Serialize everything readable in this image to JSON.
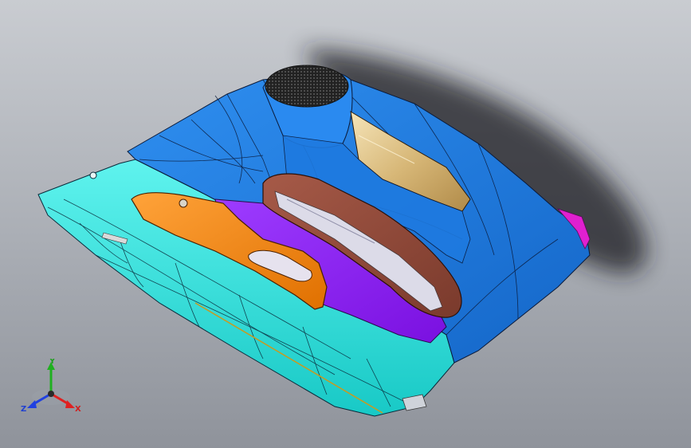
{
  "viewport": {
    "background_top": "#c9ccd1",
    "background_bottom": "#8f939b"
  },
  "model": {
    "colors": {
      "upper_panel": "#1f7fe0",
      "lower_panel": "#27e3dc",
      "armrest_pull": "#ff8a0a",
      "insert": "#8b1bf0",
      "grip_handle": "#8f4a3a",
      "speaker_grille": "#1a1a1a",
      "trim_edge": "#e020d0",
      "opening_highlight": "#e8c98a"
    }
  },
  "triad": {
    "x_label": "X",
    "y_label": "Y",
    "z_label": "Z",
    "x_color": "#e02020",
    "y_color": "#20b020",
    "z_color": "#2040e0"
  }
}
